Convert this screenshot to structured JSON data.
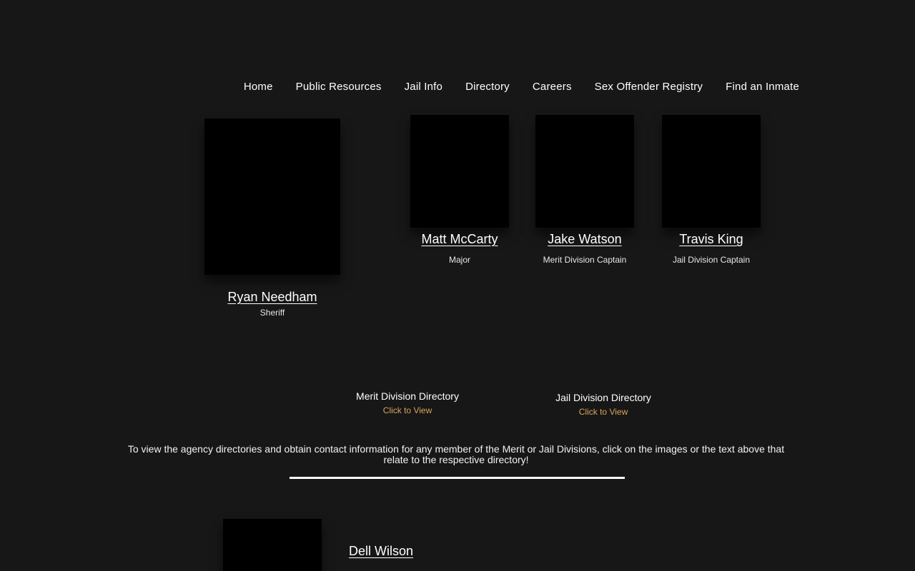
{
  "nav": {
    "items": [
      "Home",
      "Public Resources",
      "Jail Info",
      "Directory",
      "Careers",
      "Sex Offender Registry",
      "Find an Inmate"
    ]
  },
  "staff": {
    "sheriff": {
      "name": "Ryan Needham",
      "title": "Sheriff"
    },
    "major": {
      "name": "Matt McCarty",
      "title": "Major"
    },
    "merit_captain": {
      "name": "Jake Watson",
      "title": "Merit Division Captain"
    },
    "jail_captain": {
      "name": "Travis King",
      "title": "Jail Division Captain"
    },
    "additional": {
      "name": "Dell Wilson"
    }
  },
  "directories": {
    "merit": {
      "title": "Merit Division Directory",
      "link": "Click to View"
    },
    "jail": {
      "title": "Jail Division Directory",
      "link": "Click to View"
    }
  },
  "instructions": "To view the agency directories and obtain contact information for any member of the Merit or Jail Divisions, click on the images or the text above that relate to the respective directory!",
  "colors": {
    "background": "#171717",
    "accent_link": "#d9a55a",
    "text": "#ffffff"
  }
}
